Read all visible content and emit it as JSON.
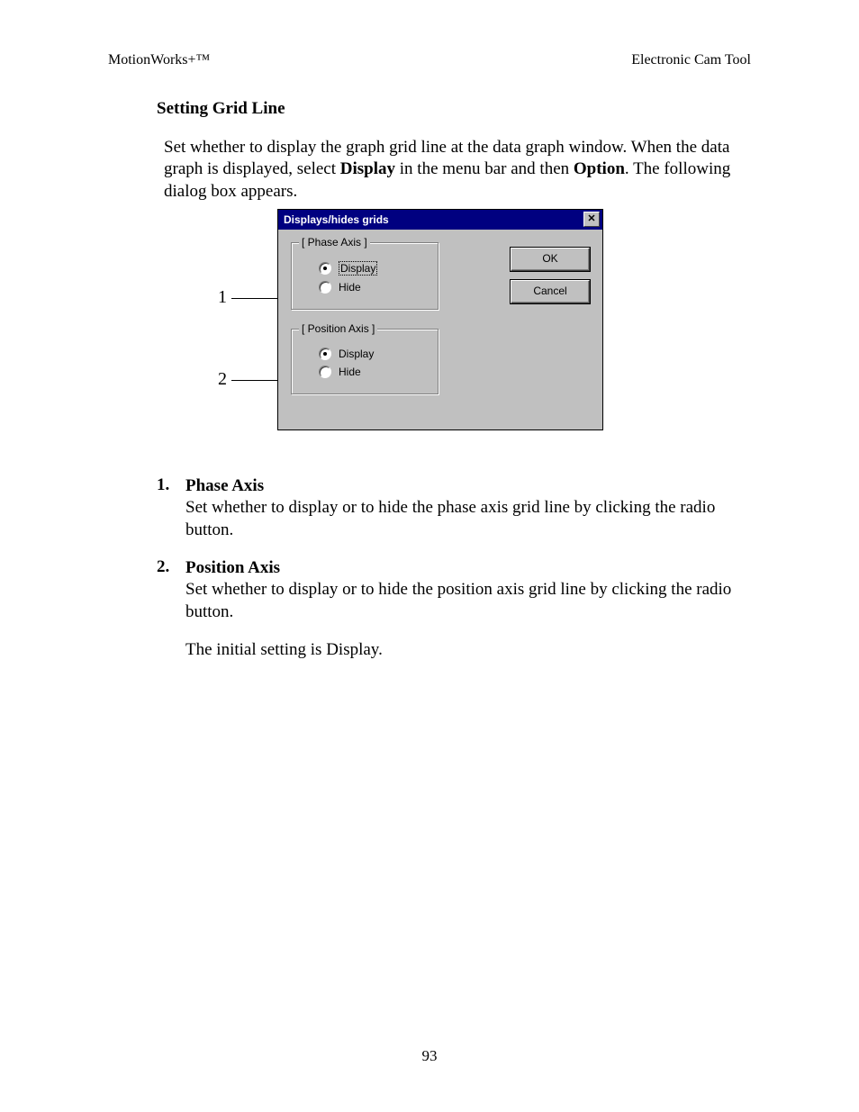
{
  "header": {
    "left": "MotionWorks+™",
    "right": "Electronic Cam Tool"
  },
  "section_title": "Setting Grid Line",
  "intro": {
    "prefix": "Set whether to display the graph grid line at the data graph window.  When the data graph is displayed, select ",
    "bold1": "Display",
    "mid": " in the menu bar and then ",
    "bold2": "Option",
    "suffix": ". The following dialog box appears."
  },
  "dialog": {
    "title": "Displays/hides grids",
    "close_glyph": "✕",
    "group1": {
      "legend": "[ Phase Axis ]",
      "opt_display": "Display",
      "opt_hide": "Hide"
    },
    "group2": {
      "legend": "[ Position Axis ]",
      "opt_display": "Display",
      "opt_hide": "Hide"
    },
    "ok": "OK",
    "cancel": "Cancel"
  },
  "callouts": {
    "c1": "1",
    "c2": "2"
  },
  "list": {
    "item1": {
      "num": "1.",
      "title": "Phase Axis",
      "desc": "Set whether to display or to hide the phase axis grid line by clicking the radio button."
    },
    "item2": {
      "num": "2.",
      "title": "Position Axis",
      "desc": "Set whether to display or to hide the position axis grid line by clicking the radio button."
    },
    "note": "The initial setting is Display."
  },
  "page_number": "93"
}
